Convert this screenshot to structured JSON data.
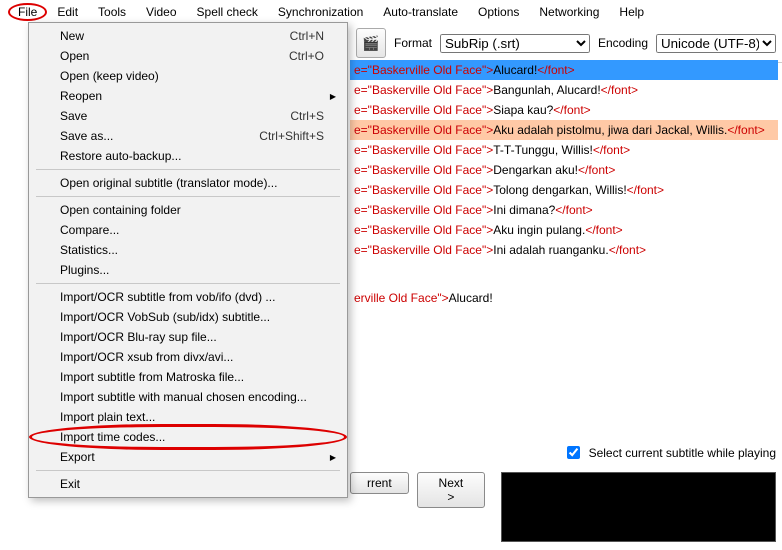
{
  "menubar": [
    "File",
    "Edit",
    "Tools",
    "Video",
    "Spell check",
    "Synchronization",
    "Auto-translate",
    "Options",
    "Networking",
    "Help"
  ],
  "format": {
    "label": "Format",
    "value": "SubRip (.srt)"
  },
  "encoding": {
    "label": "Encoding",
    "value": "Unicode (UTF-8)"
  },
  "dropdown": {
    "open": "Open",
    "new": "New",
    "new_sc": "Ctrl+N",
    "open_sc": "Ctrl+O",
    "openkeep": "Open (keep video)",
    "reopen": "Reopen",
    "save": "Save",
    "save_sc": "Ctrl+S",
    "saveas": "Save as...",
    "saveas_sc": "Ctrl+Shift+S",
    "restore": "Restore auto-backup...",
    "openorig": "Open original subtitle (translator mode)...",
    "openfolder": "Open containing folder",
    "compare": "Compare...",
    "stats": "Statistics...",
    "plugins": "Plugins...",
    "imp_vob": "Import/OCR subtitle from vob/ifo (dvd) ...",
    "imp_vobsub": "Import/OCR VobSub (sub/idx) subtitle...",
    "imp_bluray": "Import/OCR Blu-ray sup file...",
    "imp_xsub": "Import/OCR xsub from divx/avi...",
    "imp_mkv": "Import subtitle from Matroska file...",
    "imp_enc": "Import subtitle with manual chosen encoding...",
    "imp_plain": "Import plain text...",
    "imp_tc": "Import time codes...",
    "export": "Export",
    "exit": "Exit"
  },
  "prefix_open": "e=\"Baskerville Old Face\">",
  "prefix_open_long": "erville Old Face\">",
  "close_tag": "</font>",
  "lines": [
    {
      "t": "Alucard!",
      "sel": true
    },
    {
      "t": "Bangunlah, Alucard!"
    },
    {
      "t": "Siapa kau?"
    },
    {
      "t": "Aku adalah pistolmu, jiwa dari Jackal, Willis.",
      "mark": true
    },
    {
      "t": "T-T-Tunggu, Willis!"
    },
    {
      "t": "Dengarkan aku!"
    },
    {
      "t": "Tolong dengarkan, Willis!"
    },
    {
      "t": "Ini dimana?"
    },
    {
      "t": "Aku ingin pulang."
    },
    {
      "t": "Ini adalah ruanganku."
    }
  ],
  "extra_line": "Alucard!",
  "buttons": {
    "current": "rrent",
    "next": "Next >"
  },
  "check": {
    "label": "Select current subtitle while playing",
    "checked": true
  }
}
